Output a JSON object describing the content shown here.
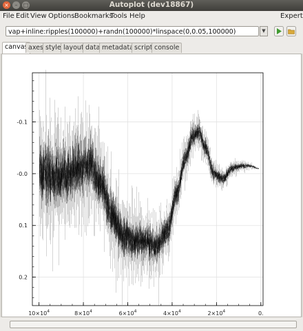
{
  "window": {
    "title": "Autoplot (dev18867)",
    "close_glyph": "×",
    "minimize_glyph": "–",
    "maximize_glyph": "□"
  },
  "menu": {
    "items": [
      "File",
      "Edit",
      "View",
      "Options",
      "Bookmarks",
      "Tools",
      "Help"
    ],
    "expert_label": "Expert"
  },
  "url": {
    "value": "vap+inline:ripples(100000)+randn(100000)*linspace(0,0.05,100000)",
    "dropdown_glyph": "▼"
  },
  "tabs": {
    "items": [
      "canvas",
      "axes",
      "style",
      "layout",
      "data",
      "metadata",
      "script",
      "console"
    ],
    "active": "canvas"
  },
  "colors": {
    "go_button": "#3f9a2f",
    "folder_icon": "#d9a93a",
    "data_dark": "#000000",
    "data_light": "#c4c4c4"
  },
  "icons": {
    "go": "play-arrow-icon",
    "open": "folder-icon"
  },
  "chart_data": {
    "type": "scatter",
    "title": "",
    "xlabel": "",
    "ylabel": "",
    "x_direction": "reversed",
    "y_direction": "reversed",
    "xlim": [
      103000,
      -1000
    ],
    "ylim": [
      -0.195,
      0.255
    ],
    "grid": true,
    "x_ticks": [
      {
        "value": 100000,
        "label": "10×10",
        "exp": "4"
      },
      {
        "value": 80000,
        "label": "8×10",
        "exp": "4"
      },
      {
        "value": 60000,
        "label": "6×10",
        "exp": "4"
      },
      {
        "value": 40000,
        "label": "4×10",
        "exp": "4"
      },
      {
        "value": 20000,
        "label": "2×10",
        "exp": "4"
      },
      {
        "value": 0,
        "label": "0.",
        "exp": ""
      }
    ],
    "y_ticks": [
      {
        "value": -0.1,
        "label": "-0.1"
      },
      {
        "value": 0.0,
        "label": "-0.0"
      },
      {
        "value": 0.1,
        "label": "0.1"
      },
      {
        "value": 0.2,
        "label": "0.2"
      }
    ],
    "n_points": 100000,
    "noise_start": 0.0,
    "noise_end": 0.05,
    "series": [
      {
        "x": [
          100000,
          92000,
          86000,
          82000,
          77000,
          72000,
          67000,
          62000,
          57000,
          52000,
          47000,
          42000,
          38000,
          34000,
          31000,
          28000,
          25000,
          21000,
          17000,
          13000,
          9000,
          5000,
          1000
        ],
        "y": [
          0.0,
          0.005,
          0.0,
          -0.01,
          -0.02,
          0.02,
          0.08,
          0.12,
          0.13,
          0.13,
          0.14,
          0.11,
          0.04,
          -0.03,
          -0.07,
          -0.08,
          -0.05,
          0.0,
          0.01,
          -0.01,
          -0.015,
          -0.015,
          -0.01
        ]
      }
    ]
  }
}
